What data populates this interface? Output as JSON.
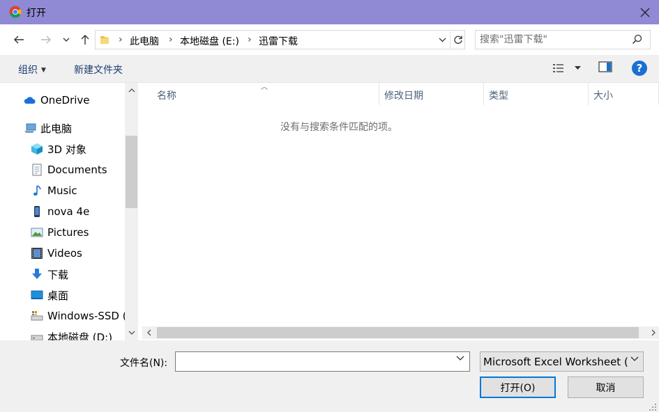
{
  "window": {
    "title": "打开",
    "icons": {
      "app": "chrome-icon",
      "close": "close-icon"
    }
  },
  "address": {
    "breadcrumbs": [
      "此电脑",
      "本地磁盘 (E:)",
      "迅雷下载"
    ],
    "icons": [
      "back-arrow-icon",
      "forward-arrow-icon",
      "recent-locations-icon",
      "up-arrow-icon",
      "folder-icon",
      "chevron-down-icon",
      "refresh-icon"
    ]
  },
  "search": {
    "placeholder": "搜索\"迅雷下载\"",
    "value": ""
  },
  "toolbar": {
    "organize_label": "组织",
    "new_folder_label": "新建文件夹",
    "icons": [
      "view-options-icon",
      "preview-pane-icon",
      "help-icon"
    ]
  },
  "nav": {
    "items": [
      {
        "label": "OneDrive",
        "icon": "onedrive-cloud-icon"
      },
      {
        "label": "此电脑",
        "icon": "this-pc-icon"
      },
      {
        "label": "3D 对象",
        "icon": "3d-objects-icon"
      },
      {
        "label": "Documents",
        "icon": "documents-icon"
      },
      {
        "label": "Music",
        "icon": "music-icon"
      },
      {
        "label": "nova 4e",
        "icon": "phone-icon"
      },
      {
        "label": "Pictures",
        "icon": "pictures-icon"
      },
      {
        "label": "Videos",
        "icon": "videos-icon"
      },
      {
        "label": "下载",
        "icon": "downloads-icon"
      },
      {
        "label": "桌面",
        "icon": "desktop-icon"
      },
      {
        "label": "Windows-SSD (",
        "icon": "drive-icon"
      },
      {
        "label": "本地磁盘 (D:)",
        "icon": "drive-icon"
      }
    ]
  },
  "files": {
    "columns": [
      "名称",
      "修改日期",
      "类型",
      "大小"
    ],
    "empty_message": "没有与搜索条件匹配的项。"
  },
  "bottom": {
    "filename_label": "文件名(N):",
    "filename_value": "",
    "filetype_value": "Microsoft Excel Worksheet (*",
    "open_label": "打开(O)",
    "cancel_label": "取消"
  },
  "colors": {
    "titlebar": "#9089d4",
    "accent": "#0078d7",
    "toolbar_bg": "#f0f0f0"
  }
}
